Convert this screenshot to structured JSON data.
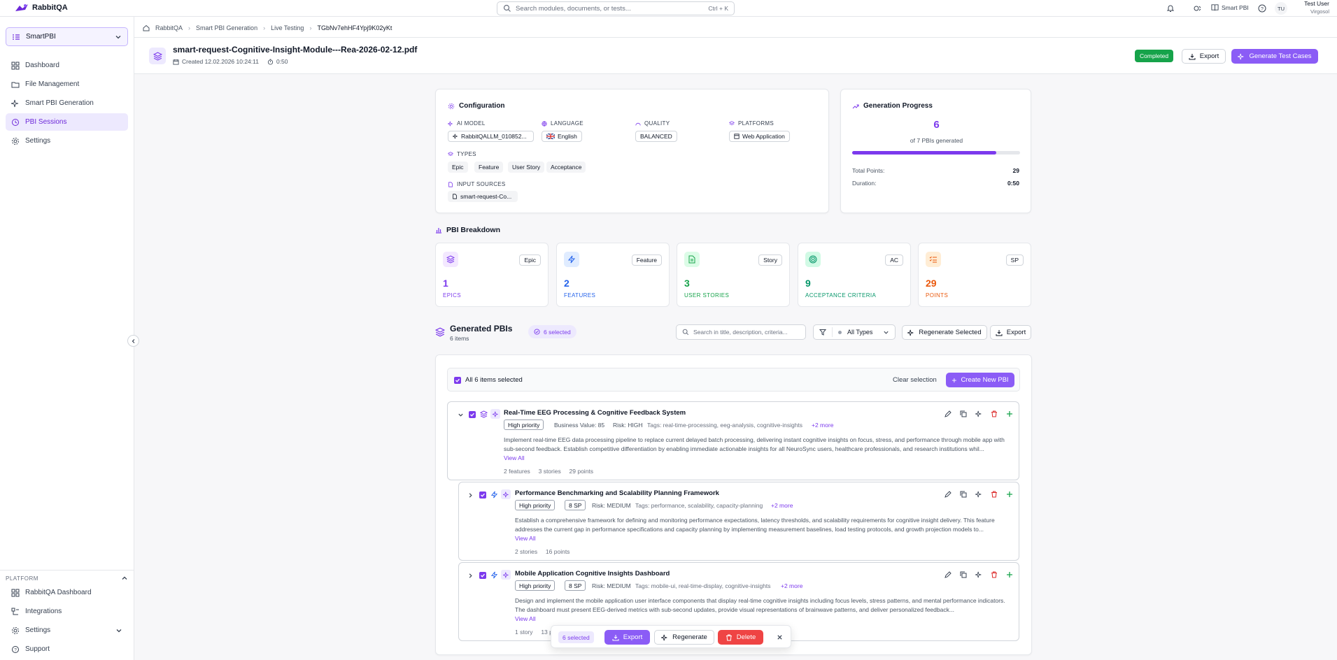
{
  "app": {
    "name": "RabbitQA"
  },
  "search": {
    "placeholder": "Search modules, documents, or tests...",
    "shortcut": "Ctrl + K"
  },
  "topbar": {
    "smart_pbi": "Smart PBI",
    "avatar_initials": "TU",
    "user_name": "Test User",
    "user_org": "Virgosol"
  },
  "sidebar": {
    "workspace": "SmartPBI",
    "items": [
      {
        "label": "Dashboard"
      },
      {
        "label": "File Management"
      },
      {
        "label": "Smart PBI Generation"
      },
      {
        "label": "PBI Sessions"
      },
      {
        "label": "Settings"
      }
    ],
    "platform_heading": "PLATFORM",
    "platform_items": [
      {
        "label": "RabbitQA Dashboard"
      },
      {
        "label": "Integrations"
      },
      {
        "label": "Settings"
      },
      {
        "label": "Support"
      }
    ]
  },
  "breadcrumb": [
    "RabbitQA",
    "Smart PBI Generation",
    "Live Testing",
    "TGbNv7ehHF4Ypj9K02yKt"
  ],
  "header": {
    "title": "smart-request-Cognitive-Insight-Module---Rea-2026-02-12.pdf",
    "created": "Created 12.02.2026 10:24:11",
    "duration": "0:50",
    "status": "Completed",
    "export": "Export",
    "generate": "Generate Test Cases"
  },
  "config": {
    "title": "Configuration",
    "ai_model_label": "AI MODEL",
    "ai_model": "RabbitQALLM_010852...",
    "language_label": "LANGUAGE",
    "language": "English",
    "quality_label": "QUALITY",
    "quality": "BALANCED",
    "platforms_label": "PLATFORMS",
    "platform": "Web Application",
    "types_label": "TYPES",
    "types": [
      "Epic",
      "Feature",
      "User Story",
      "Acceptance"
    ],
    "inputs_label": "INPUT SOURCES",
    "input": "smart-request-Co..."
  },
  "progress": {
    "title": "Generation Progress",
    "count": "6",
    "subtitle": "of 7 PBIs generated",
    "fraction": 0.857,
    "points_label": "Total Points:",
    "points": "29",
    "duration_label": "Duration:",
    "duration": "0:50"
  },
  "breakdown": {
    "title": "PBI Breakdown",
    "cards": [
      {
        "badge": "Epic",
        "value": "1",
        "label": "EPICS",
        "color": "#7c3aed",
        "bg": "#f3e8ff",
        "icon": "layers-icon"
      },
      {
        "badge": "Feature",
        "value": "2",
        "label": "FEATURES",
        "color": "#2563eb",
        "bg": "#e0ecff",
        "icon": "bolt-icon"
      },
      {
        "badge": "Story",
        "value": "3",
        "label": "USER STORIES",
        "color": "#16a34a",
        "bg": "#dcfce7",
        "icon": "document-icon"
      },
      {
        "badge": "AC",
        "value": "9",
        "label": "ACCEPTANCE CRITERIA",
        "color": "#059669",
        "bg": "#d1fae5",
        "icon": "target-icon"
      },
      {
        "badge": "SP",
        "value": "29",
        "label": "POINTS",
        "color": "#ea580c",
        "bg": "#ffedd5",
        "icon": "list-icon"
      }
    ]
  },
  "generated": {
    "title": "Generated PBIs",
    "count": "6 items",
    "selected": "6 selected",
    "search_placeholder": "Search in title, description, criteria...",
    "filter": "All Types",
    "regenerate": "Regenerate Selected",
    "export": "Export",
    "all_selected": "All 6 items selected",
    "clear": "Clear selection",
    "create": "Create New PBI"
  },
  "pbis": [
    {
      "title": "Real-Time EEG Processing & Cognitive Feedback System",
      "priority": "High priority",
      "meta": "Business Value: 85",
      "risk": "Risk: HIGH",
      "tags": "Tags: real-time-processing, eeg-analysis, cognitive-insights",
      "more": "+2 more",
      "desc": "Implement real-time EEG data processing pipeline to replace current delayed batch processing, delivering instant cognitive insights on focus, stress, and performance through mobile app with sub-second feedback. Establish competitive differentiation by enabling immediate actionable insights for all NeuroSync users, healthcare professionals, and research institutions whil...",
      "view": "View All",
      "stats": "2 features     3 stories     29 points"
    },
    {
      "title": "Performance Benchmarking and Scalability Planning Framework",
      "priority": "High priority",
      "meta": "8 SP",
      "risk": "Risk: MEDIUM",
      "tags": "Tags: performance, scalability, capacity-planning",
      "more": "+2 more",
      "desc": "Establish a comprehensive framework for defining and monitoring performance expectations, latency thresholds, and scalability requirements for cognitive insight delivery. This feature addresses the current gap in performance specifications and capacity planning by implementing measurement baselines, load testing protocols, and growth projection models to...",
      "view": "View All",
      "stats": "2 stories     16 points"
    },
    {
      "title": "Mobile Application Cognitive Insights Dashboard",
      "priority": "High priority",
      "meta": "8 SP",
      "risk": "Risk: MEDIUM",
      "tags": "Tags: mobile-ui, real-time-display, cognitive-insights",
      "more": "+2 more",
      "desc": "Design and implement the mobile application user interface components that display real-time cognitive insights including focus levels, stress patterns, and mental performance indicators. The dashboard must present EEG-derived metrics with sub-second updates, provide visual representations of brainwave patterns, and deliver personalized feedback...",
      "view": "View All",
      "stats": "1 story     13 p"
    }
  ],
  "floatbar": {
    "selected": "6 selected",
    "export": "Export",
    "regenerate": "Regenerate",
    "delete": "Delete"
  }
}
